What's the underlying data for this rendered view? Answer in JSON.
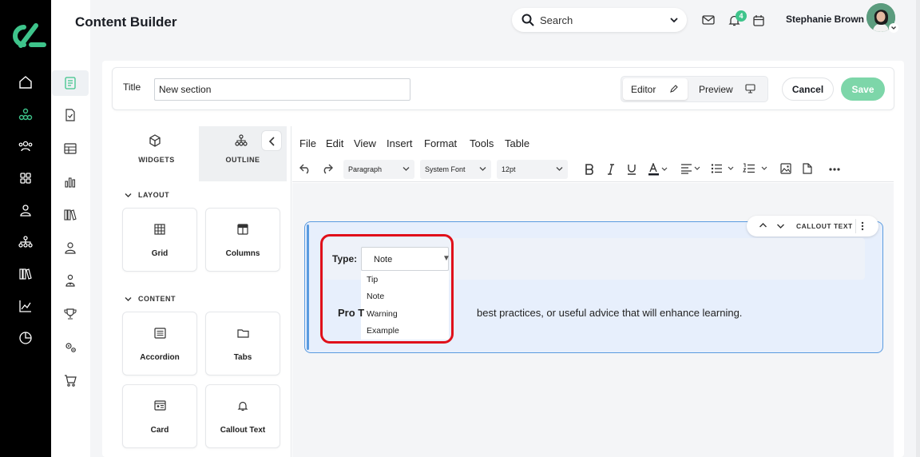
{
  "app": {
    "page_title": "Content Builder"
  },
  "header": {
    "search_label": "Search",
    "notification_count": "4",
    "user_name": "Stephanie Brown"
  },
  "title_bar": {
    "title_label": "Title",
    "title_value": "New section",
    "mode_editor": "Editor",
    "mode_preview": "Preview",
    "cancel_label": "Cancel",
    "save_label": "Save"
  },
  "widgets_panel": {
    "tab_widgets": "WIDGETS",
    "tab_outline": "OUTLINE",
    "section_layout": "LAYOUT",
    "section_content": "CONTENT",
    "layout_items": [
      "Grid",
      "Columns"
    ],
    "content_items": [
      "Accordion",
      "Tabs",
      "Card",
      "Callout Text"
    ]
  },
  "editor": {
    "menu": [
      "File",
      "Edit",
      "View",
      "Insert",
      "Format",
      "Tools",
      "Table"
    ],
    "block_format": "Paragraph",
    "font_family": "System Font",
    "font_size": "12pt"
  },
  "callout": {
    "toolbar_label": "CALLOUT TEXT",
    "type_label": "Type:",
    "type_value": "Note",
    "type_options": [
      "Tip",
      "Note",
      "Warning",
      "Example"
    ],
    "body_prefix": "Pro T",
    "body_rest": "best practices, or useful advice that will enhance learning."
  },
  "colors": {
    "accent_green": "#3ec48b",
    "save_button": "#7dd6a9",
    "callout_border": "#5a9be0",
    "callout_bg": "#e7effc",
    "highlight_red": "#e0101a"
  }
}
